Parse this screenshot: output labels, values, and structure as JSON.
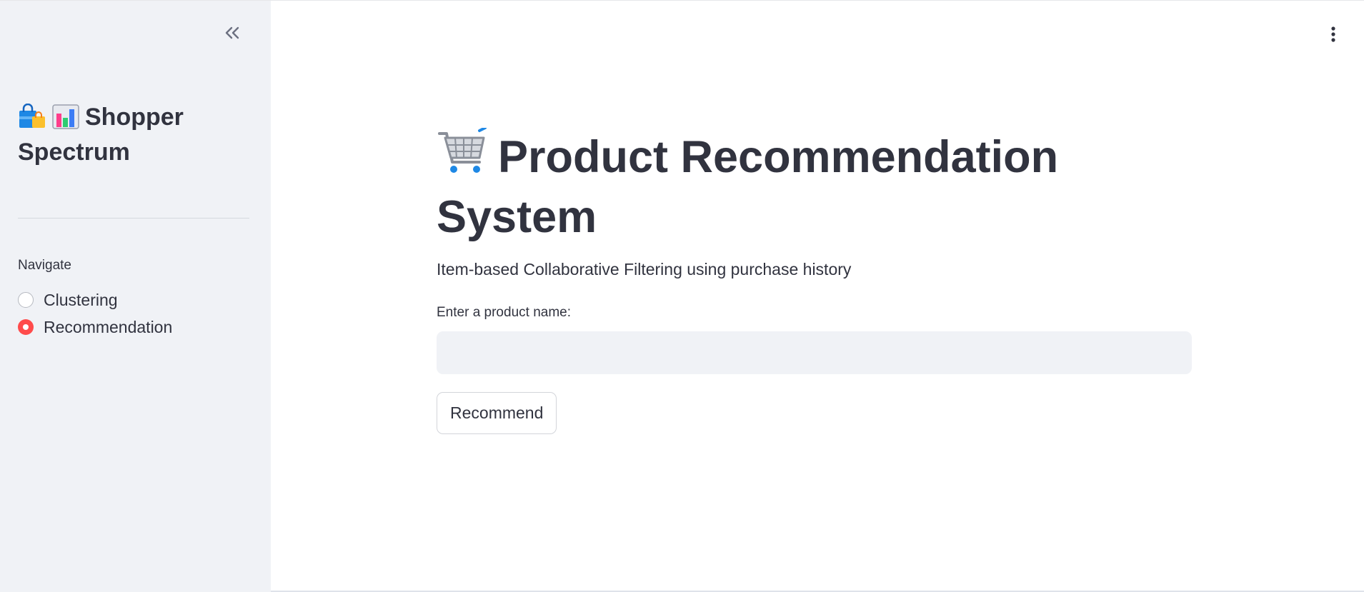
{
  "sidebar": {
    "collapse_icon": "double-chevron-left-icon",
    "title": "Shopper Spectrum",
    "title_icons": [
      "shopping-bags-icon",
      "bar-chart-icon"
    ],
    "nav_label": "Navigate",
    "options": [
      {
        "label": "Clustering",
        "selected": false
      },
      {
        "label": "Recommendation",
        "selected": true
      }
    ]
  },
  "header": {
    "menu_icon": "kebab-menu-icon"
  },
  "main": {
    "title_icon": "shopping-cart-icon",
    "title": "Product Recommendation System",
    "subtitle": "Item-based Collaborative Filtering using purchase history",
    "input_label": "Enter a product name:",
    "input_value": "",
    "input_placeholder": "",
    "button_label": "Recommend"
  },
  "colors": {
    "accent": "#ff4b4b",
    "sidebar_bg": "#f0f2f6",
    "text": "#31333f"
  }
}
